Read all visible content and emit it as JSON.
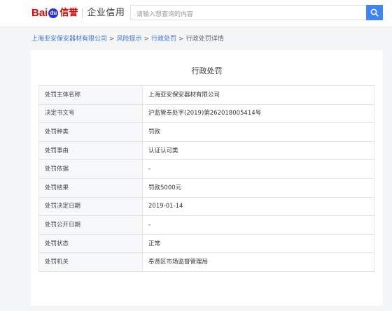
{
  "header": {
    "logo_bai": "Bai",
    "logo_du": "du",
    "logo_xinyu": "信誉",
    "brand": "企业信用",
    "search_placeholder": "请输入想查询的内容",
    "search_icon": "search-icon",
    "accent_color": "#3e84f5",
    "logo_red": "#e10601",
    "logo_blue": "#2932e1"
  },
  "breadcrumb": {
    "items": [
      "上海亚安保安器材有限公司",
      "风险提示",
      "行政处罚"
    ],
    "separator": ">",
    "current": "行政处罚详情",
    "link_color": "#3c76d6"
  },
  "card": {
    "title": "行政处罚",
    "rows": [
      {
        "key": "处罚主体名称",
        "value": "上海亚安保安器材有限公司"
      },
      {
        "key": "决定书文号",
        "value": "沪监管奉处字(2019)第262018005414号"
      },
      {
        "key": "处罚种类",
        "value": "罚款"
      },
      {
        "key": "处罚事由",
        "value": "认证认可类"
      },
      {
        "key": "处罚依据",
        "value": "-"
      },
      {
        "key": "处罚结果",
        "value": "罚款5000元"
      },
      {
        "key": "处罚决定日期",
        "value": "2019-01-14"
      },
      {
        "key": "处罚公开日期",
        "value": "-"
      },
      {
        "key": "处罚状态",
        "value": "正常"
      },
      {
        "key": "处罚机关",
        "value": "奉贤区市场监督管理局"
      }
    ]
  }
}
